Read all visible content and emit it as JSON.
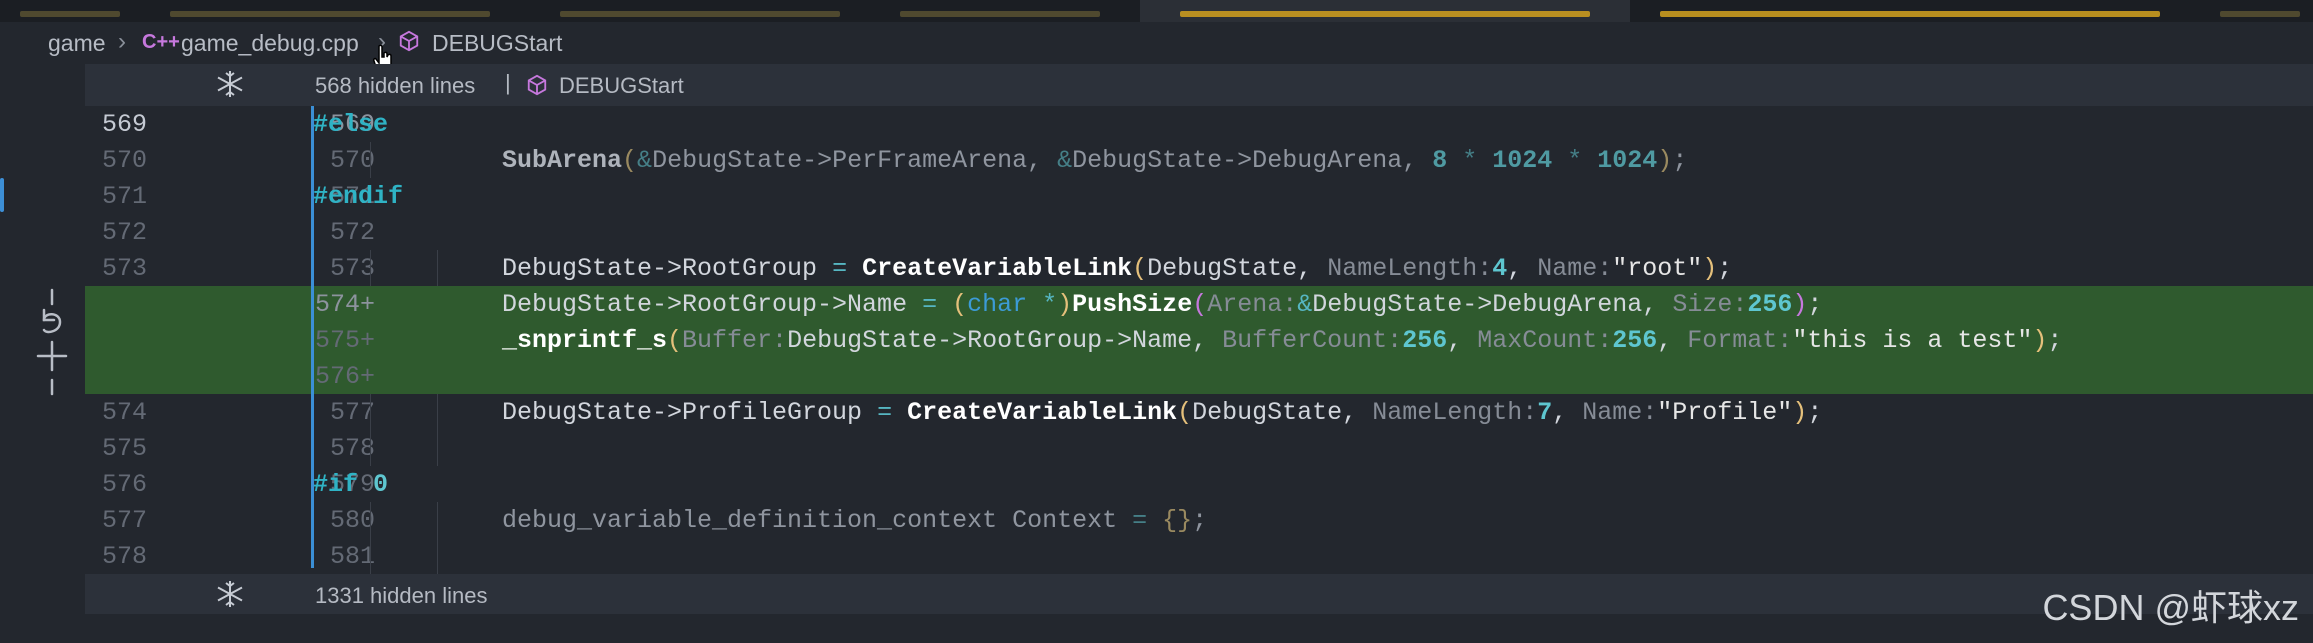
{
  "breadcrumb": {
    "folder": "game",
    "file": "game_debug.cpp",
    "file_icon": "C++",
    "symbol": "DEBUGStart"
  },
  "fold_top": {
    "text": "568 hidden lines",
    "separator": "|",
    "symbol": "DEBUGStart"
  },
  "fold_bottom": {
    "text": "1331 hidden lines"
  },
  "lines": [
    {
      "old": "569",
      "new": "569",
      "current": true
    },
    {
      "old": "570",
      "new": "570"
    },
    {
      "old": "571",
      "new": "571"
    },
    {
      "old": "572",
      "new": "572"
    },
    {
      "old": "573",
      "new": "573"
    },
    {
      "old": "",
      "new": "574+",
      "added": true
    },
    {
      "old": "",
      "new": "575+",
      "added": true
    },
    {
      "old": "",
      "new": "576+",
      "added": true
    },
    {
      "old": "574",
      "new": "577"
    },
    {
      "old": "575",
      "new": "578"
    },
    {
      "old": "576",
      "new": "579"
    },
    {
      "old": "577",
      "new": "580"
    },
    {
      "old": "578",
      "new": "581"
    }
  ],
  "code": {
    "l569": {
      "t1": "#else"
    },
    "l570": {
      "fn": "SubArena",
      "p1": "(",
      "o1": "&",
      "a1": "DebugState->PerFrameArena, ",
      "o2": "&",
      "a2": "DebugState->DebugArena, ",
      "n1": "8",
      "o3": " * ",
      "n2": "1024",
      "o4": " * ",
      "n3": "1024",
      "p2": ")",
      "end": ";"
    },
    "l571": {
      "t1": "#endif"
    },
    "l573": {
      "a": "DebugState->RootGroup ",
      "eq": "=",
      "sp": " ",
      "fn": "CreateVariableLink",
      "p1": "(",
      "b": "DebugState, ",
      "h1": "NameLength:",
      "n1": "4",
      "c": ", ",
      "h2": "Name:",
      "s1": "\"root\"",
      "p2": ")",
      "end": ";"
    },
    "l574": {
      "a": "DebugState->RootGroup->Name ",
      "eq": "=",
      "sp": " ",
      "p0": "(",
      "kw": "char",
      "star": " *",
      "p0c": ")",
      "fn": "PushSize",
      "p1": "(",
      "h1": "Arena:",
      "amp": "&",
      "b": "DebugState->DebugArena, ",
      "h2": "Size:",
      "n1": "256",
      "p2": ")",
      "end": ";"
    },
    "l575": {
      "fn": "_snprintf_s",
      "p1": "(",
      "h1": "Buffer:",
      "b": "DebugState->RootGroup->Name, ",
      "h2": "BufferCount:",
      "n1": "256",
      "c1": ", ",
      "h3": "MaxCount:",
      "n2": "256",
      "c2": ", ",
      "h4": "Format:",
      "s1": "\"this is a test\"",
      "p2": ")",
      "end": ";"
    },
    "l577": {
      "a": "DebugState->ProfileGroup ",
      "eq": "=",
      "sp": " ",
      "fn": "CreateVariableLink",
      "p1": "(",
      "b": "DebugState, ",
      "h1": "NameLength:",
      "n1": "7",
      "c": ", ",
      "h2": "Name:",
      "s1": "\"Profile\"",
      "p2": ")",
      "end": ";"
    },
    "l579": {
      "t1": "#if",
      "n1": "0"
    },
    "l580": {
      "a": "debug_variable_definition_context ",
      "b": "Context",
      "eq": " = ",
      "br": "{}",
      "end": ";"
    }
  },
  "watermark": "CSDN @虾球xz",
  "colors": {
    "added_bg": "#2f5a2e",
    "editor_bg": "#23272e",
    "accent": "#3b8fd6"
  }
}
